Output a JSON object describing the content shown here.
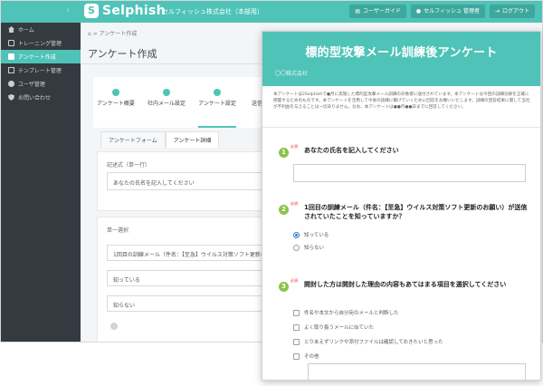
{
  "app": {
    "logo_text": "Selphish",
    "logo_mark": "S",
    "company": "セルフィッシュ株式会社（本部用）",
    "top_buttons": [
      "ユーザーガイド",
      "セルフィッシュ 管理者",
      "ログアウト"
    ],
    "sidebar_toggle": "‹",
    "sidebar": [
      {
        "label": "ホーム",
        "icon": "home-icon"
      },
      {
        "label": "トレーニング管理",
        "icon": "training-icon"
      },
      {
        "label": "アンケート作成",
        "icon": "survey-icon",
        "active": true
      },
      {
        "label": "テンプレート管理",
        "icon": "template-icon"
      },
      {
        "label": "ユーザ管理",
        "icon": "user-icon"
      },
      {
        "label": "お問い合わせ",
        "icon": "shield-icon"
      }
    ],
    "breadcrumb": "⌂ > アンケート作成",
    "page_title": "アンケート作成",
    "steps": [
      "アンケート概要",
      "社内メール設定",
      "アンケート設定",
      "送信所見設定"
    ],
    "active_step": 2,
    "subtabs": [
      "アンケートフォーム",
      "アンケート詳細"
    ],
    "active_subtab": 1,
    "card1": {
      "label": "記述式（単一行）",
      "value": "あなたの氏名を記入してください"
    },
    "card2": {
      "label": "単一選択",
      "question": "1回目の訓練メール（件名：【至急】ウイルス対策ソフト更新のお",
      "options": [
        "知っている",
        "知らない"
      ]
    }
  },
  "survey": {
    "title": "標的型攻撃メール訓練後アンケート",
    "org": "〇〇株式会社",
    "intro": "本アンケートは2Selphishで●月に実施した標的型攻撃メール訓練の対象者に送付されています。本アンケートは今回の訓練効果を正確に把握するためのものです。本アンケートを活用して今後の訓練に繋げていくために回答をお願いいたします。訓練の回答結果に関して当社が不利益を与えることは一切ありません。なお、本アンケートは●●月●●日までに回答してください。",
    "required_label": "必須",
    "questions": [
      {
        "num": "1",
        "text": "あなたの氏名を記入してください"
      },
      {
        "num": "2",
        "text": "1回目の訓練メール（件名：【至急】ウイルス対策ソフト更新のお願い）が送信されていたことを知っていますか？",
        "options": [
          "知っている",
          "知らない"
        ],
        "selected": 0
      },
      {
        "num": "3",
        "text": "開封した方は開封した理由の内容もあてはまる項目を選択してください",
        "options": [
          "件名や本文から自分宛のメールと判断した",
          "よく取り扱うメールに似ていた",
          "とりあえずリンクや添付ファイルは確認しておきたいと思った",
          "その他"
        ]
      }
    ]
  },
  "colors": {
    "accent": "#4fc3b8",
    "sidebar": "#333a40",
    "question_number": "#8bc34a",
    "required": "#e53935",
    "radio_selected": "#2f7fd8"
  }
}
